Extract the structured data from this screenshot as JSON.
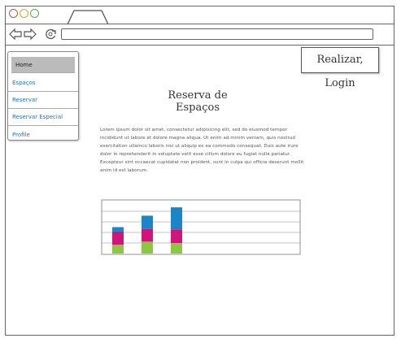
{
  "browser": {
    "colors": {
      "close": "#e04343",
      "minimize": "#e6a42a",
      "maximize": "#4caf50"
    }
  },
  "sidebar": {
    "items": [
      {
        "label": "Home",
        "active": true
      },
      {
        "label": "Espaços",
        "active": false
      },
      {
        "label": "Reservar",
        "active": false
      },
      {
        "label": "Reservar Especial",
        "active": false
      },
      {
        "label": "Profile",
        "active": false
      }
    ]
  },
  "header": {
    "login_label": "Realizar, Login"
  },
  "main": {
    "title": "Reserva de Espaços",
    "body": "Lorem ipsum dolor sit amet, consectetur adipisicing elit, sed do eiusmod tempor incididunt ut labore et dolore magna aliqua. Ut enim ad minim veniam, quis nostrud exercitation ullamco laboris nisi ut aliquip ex ea commodo consequat. Duis aute irure dolor in reprehenderit in voluptate velit esse cillum dolore eu fugiat nulla pariatur. Excepteur sint occaecat cupidatat non proident, sunt in culpa qui officia deserunt mollit anim id est laborum."
  },
  "chart_data": {
    "type": "bar",
    "stacked": true,
    "categories": [
      "",
      "",
      ""
    ],
    "series": [
      {
        "values": [
          2.0,
          2.7,
          2.4
        ],
        "color": "#8dc63f"
      },
      {
        "values": [
          3.0,
          2.9,
          3.1
        ],
        "color": "#d0157a"
      },
      {
        "values": [
          1.0,
          3.0,
          5.0
        ],
        "color": "#1a86c8"
      }
    ],
    "ylim": [
      0,
      12
    ],
    "grid": true,
    "title": "",
    "xlabel": "",
    "ylabel": ""
  }
}
